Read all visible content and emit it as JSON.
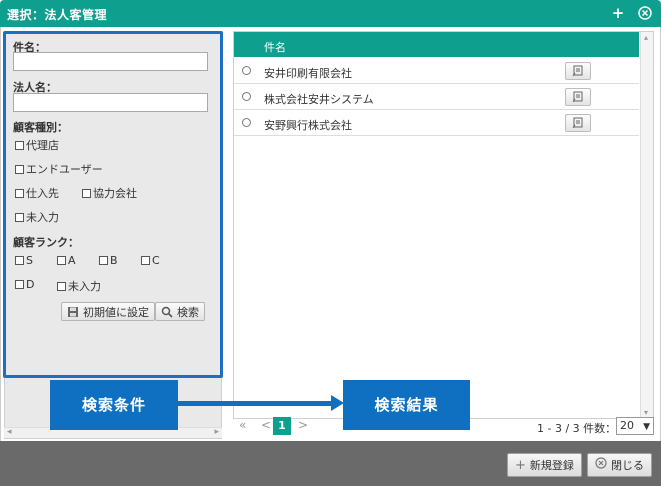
{
  "dialog": {
    "title": "選択：法人客管理",
    "plus_icon": "plus-icon",
    "close_icon": "close-circle-icon"
  },
  "search": {
    "subject_label": "件名：",
    "subject_value": "",
    "corp_label": "法人名：",
    "corp_value": "",
    "type_label": "顧客種別：",
    "types": [
      "代理店",
      "エンドユーザー",
      "仕入先",
      "協力会社",
      "未入力"
    ],
    "rank_label": "顧客ランク：",
    "ranks": [
      "S",
      "A",
      "B",
      "C",
      "D",
      "未入力"
    ],
    "reset_button": "初期値に設定",
    "search_button": "検索"
  },
  "results": {
    "column_header": "件名",
    "rows": [
      "安井印刷有限会社",
      "株式会社安井システム",
      "安野興行株式会社"
    ],
    "pager": {
      "first": "«",
      "prev": "<",
      "current_page": "1",
      "next": ">"
    },
    "count_text": "1 - 3 / 3 件数：",
    "per_page": "20"
  },
  "callouts": {
    "left": "検索条件",
    "right": "検索結果"
  },
  "footer": {
    "new_button": "新規登録",
    "close_button": "閉じる"
  },
  "colors": {
    "accent": "#0f9f8f",
    "callout": "#0f6fc0",
    "footer": "#6a6a6a"
  }
}
